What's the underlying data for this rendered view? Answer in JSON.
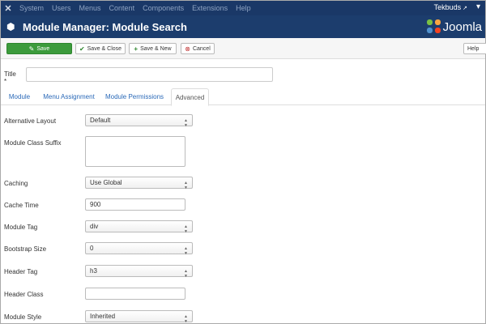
{
  "topnav": {
    "menu": [
      "System",
      "Users",
      "Menus",
      "Content",
      "Components",
      "Extensions",
      "Help"
    ],
    "user": "Tekbuds"
  },
  "header": {
    "title": "Module Manager: Module Search",
    "brand": "Joomla"
  },
  "toolbar": {
    "save": "Save",
    "save_close": "Save & Close",
    "save_new": "Save & New",
    "cancel": "Cancel",
    "help": "Help"
  },
  "title_field": {
    "label": "Title *",
    "value": ""
  },
  "tabs": [
    "Module",
    "Menu Assignment",
    "Module Permissions",
    "Advanced"
  ],
  "fields": {
    "alt_layout": {
      "label": "Alternative Layout",
      "value": "Default"
    },
    "class_suffix": {
      "label": "Module Class Suffix",
      "value": ""
    },
    "caching": {
      "label": "Caching",
      "value": "Use Global"
    },
    "cache_time": {
      "label": "Cache Time",
      "value": "900"
    },
    "module_tag": {
      "label": "Module Tag",
      "value": "div"
    },
    "bootstrap_size": {
      "label": "Bootstrap Size",
      "value": "0"
    },
    "header_tag": {
      "label": "Header Tag",
      "value": "h3"
    },
    "header_class": {
      "label": "Header Class",
      "value": ""
    },
    "module_style": {
      "label": "Module Style",
      "value": "Inherited"
    }
  },
  "colors": {
    "nav_bg": "#1a3867",
    "header_bg": "#1c3d6d",
    "save_green": "#3c9b3c",
    "link_blue": "#2a69b8"
  }
}
